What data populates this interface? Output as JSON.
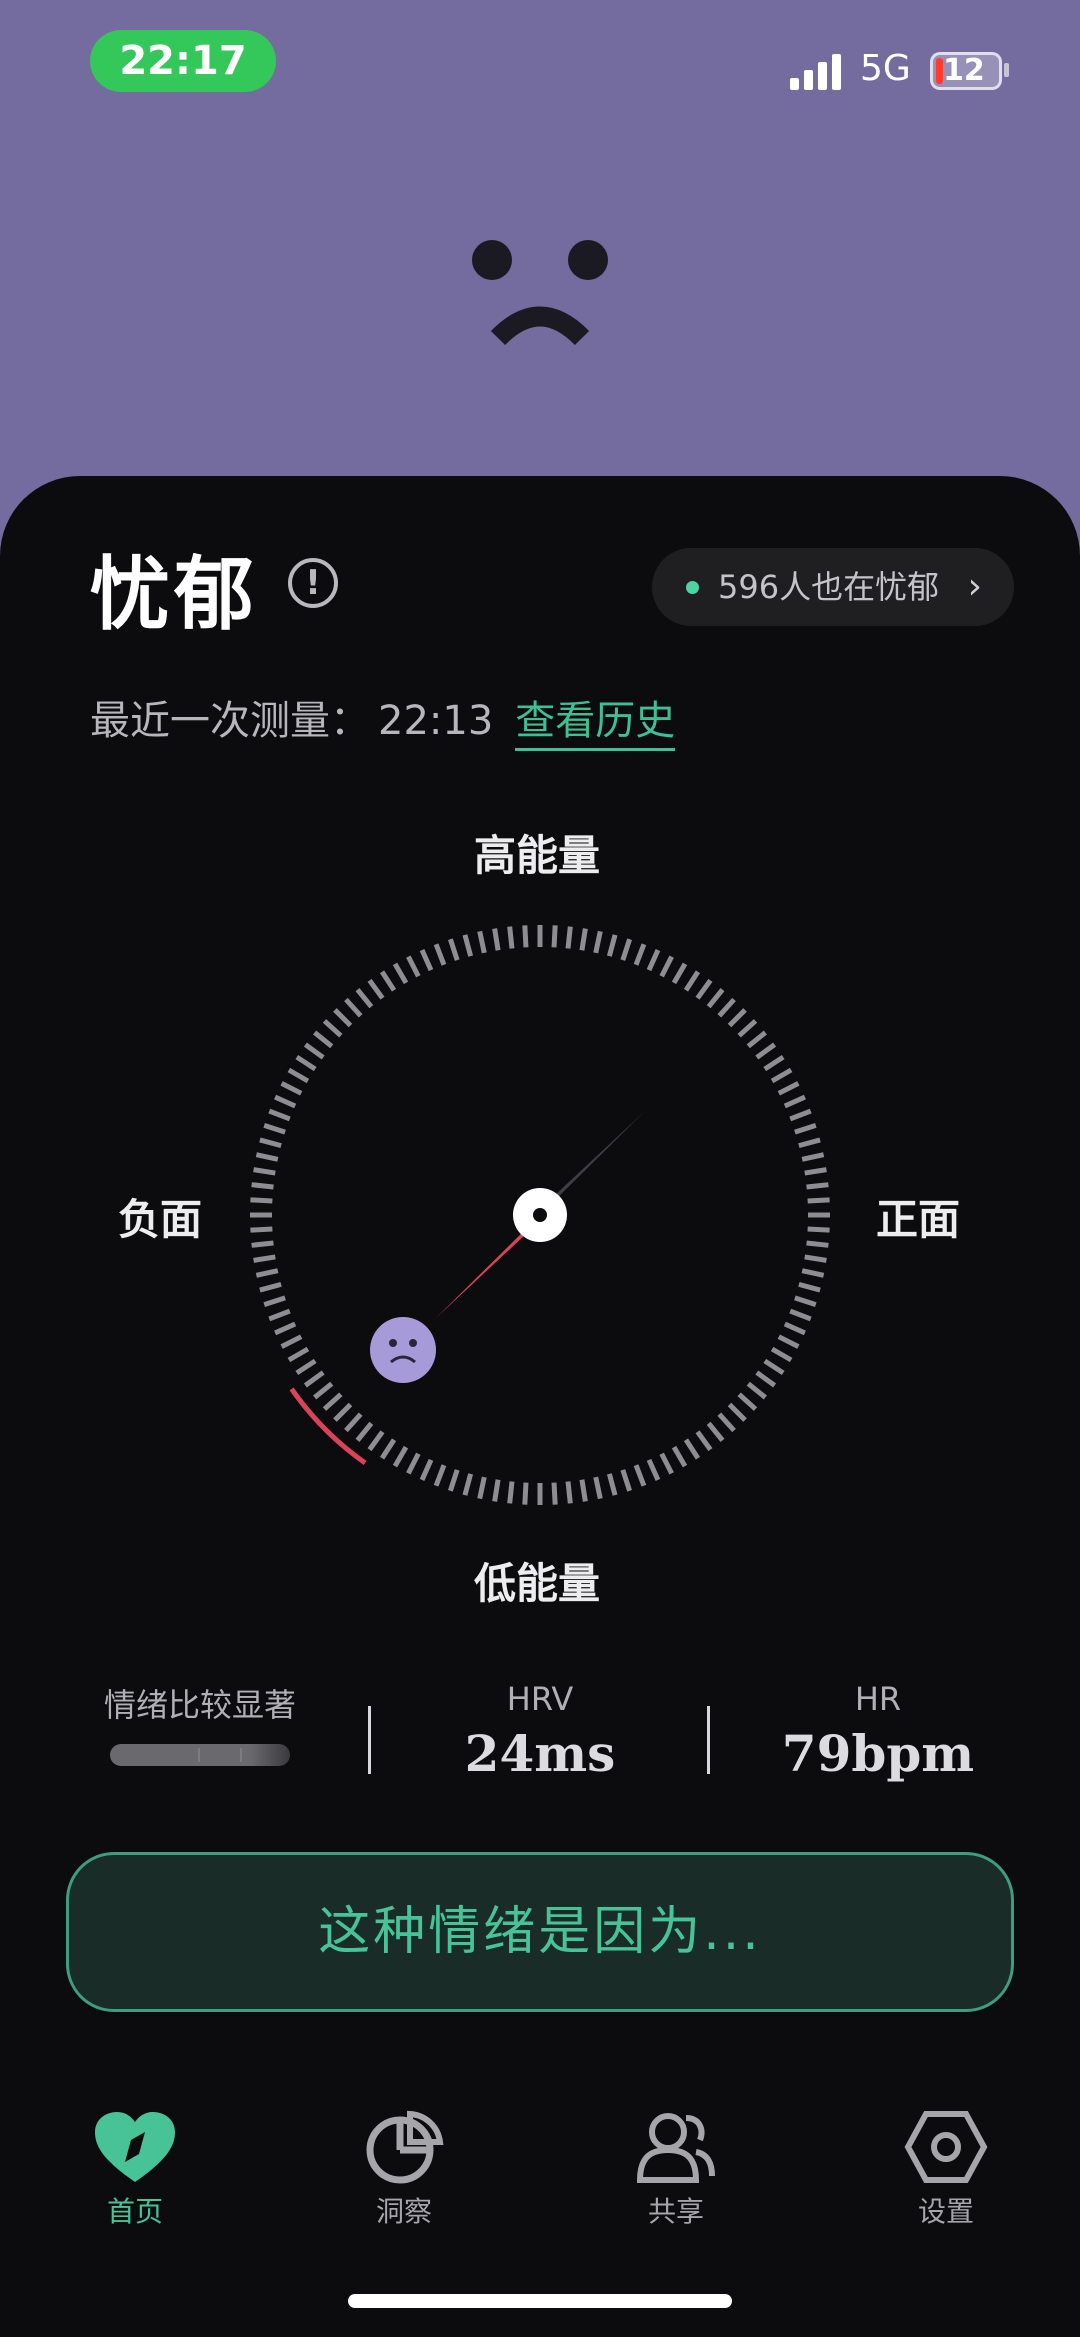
{
  "status_bar": {
    "time": "22:17",
    "network": "5G",
    "battery": "12"
  },
  "mood": {
    "title": "忧郁",
    "people_count_text": "596人也在忧郁",
    "last_measure_label": "最近一次测量：",
    "last_measure_time": "22:13",
    "history_link": "查看历史"
  },
  "compass": {
    "top_label": "高能量",
    "bottom_label": "低能量",
    "left_label": "负面",
    "right_label": "正面",
    "needle_angle_deg": 235,
    "emoji": "sad-face-icon"
  },
  "stats": {
    "contrast_label": "情绪比较显著",
    "hrv_label": "HRV",
    "hrv_value": "24ms",
    "hr_label": "HR",
    "hr_value": "79bpm"
  },
  "cause_button": "这种情绪是因为...",
  "tabs": [
    {
      "label": "首页",
      "icon": "heart-compass-icon",
      "active": true
    },
    {
      "label": "洞察",
      "icon": "pie-chart-icon",
      "active": false
    },
    {
      "label": "共享",
      "icon": "people-icon",
      "active": false
    },
    {
      "label": "设置",
      "icon": "hexagon-gear-icon",
      "active": false
    }
  ],
  "colors": {
    "accent": "#47c397",
    "background_top": "#746c9f",
    "sheet": "#0c0c0e",
    "needle_red": "#d9435a"
  }
}
